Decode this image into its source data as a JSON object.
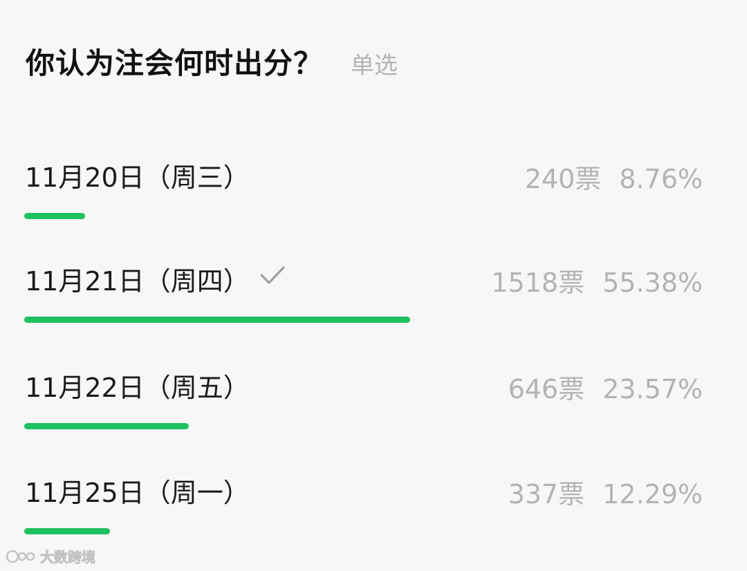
{
  "poll": {
    "question": "你认为注会何时出分？",
    "mode_label": "单选",
    "options": [
      {
        "label": "11月20日（周三）",
        "votes": "240票",
        "percent": "8.76%",
        "fraction": 0.0876,
        "selected": false
      },
      {
        "label": "11月21日（周四）",
        "votes": "1518票",
        "percent": "55.38%",
        "fraction": 0.5538,
        "selected": true
      },
      {
        "label": "11月22日（周五）",
        "votes": "646票",
        "percent": "23.57%",
        "fraction": 0.2357,
        "selected": false
      },
      {
        "label": "11月25日（周一）",
        "votes": "337票",
        "percent": "12.29%",
        "fraction": 0.1229,
        "selected": false
      }
    ],
    "bar_color": "#1ec15f",
    "check_icon": "checkmark-icon"
  },
  "watermark": {
    "text": "大数跨境"
  }
}
